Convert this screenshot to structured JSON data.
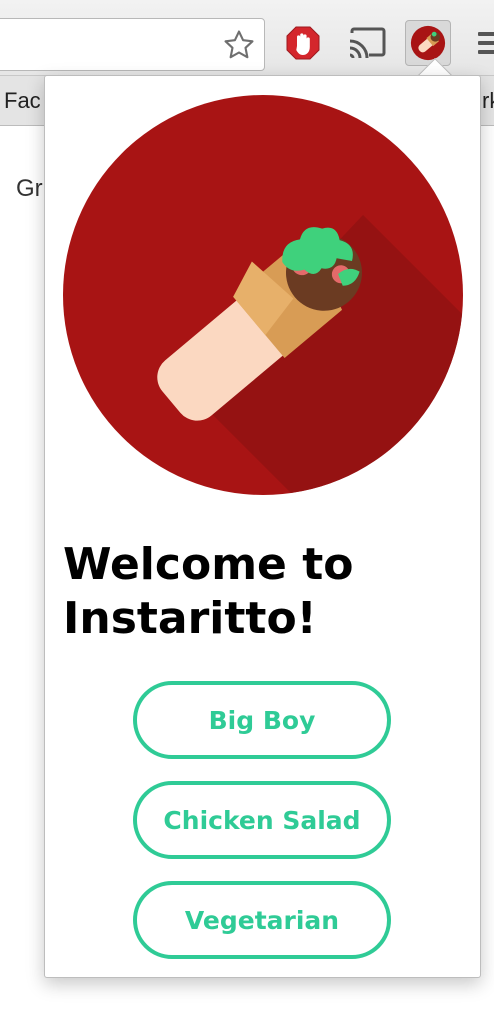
{
  "browser": {
    "bookmarks": {
      "left_label": "Fac",
      "right_label": "rk"
    },
    "toolbar_icons": [
      "star-icon",
      "adblock-icon",
      "cast-icon",
      "instaritto-extension-icon",
      "menu-icon"
    ]
  },
  "page": {
    "visible_text": "Gr"
  },
  "popup": {
    "hero_icon": "burrito-icon",
    "title": "Welcome to Instaritto!",
    "options": [
      {
        "label": "Big Boy"
      },
      {
        "label": "Chicken Salad"
      },
      {
        "label": "Vegetarian"
      }
    ]
  },
  "colors": {
    "accent": "#2fcb96",
    "hero_background": "#a81414",
    "adblock_red": "#d4262c"
  }
}
